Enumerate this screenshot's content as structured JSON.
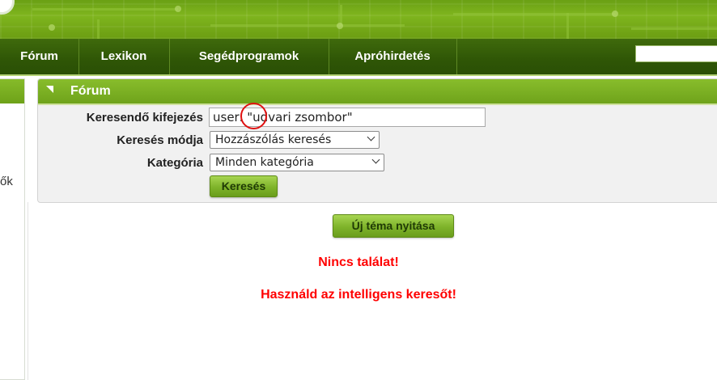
{
  "nav": {
    "items": [
      "Fórum",
      "Lexikon",
      "Segédprogramok",
      "Apróhirdetés"
    ],
    "search_value": ""
  },
  "sidebar": {
    "partial_text": "ők"
  },
  "panel": {
    "title": "Fórum",
    "fields": {
      "query_label": "Keresendő kifejezés",
      "query_value": "user: \"udvari zsombor\"",
      "mode_label": "Keresés módja",
      "mode_value": "Hozzászólás keresés",
      "category_label": "Kategória",
      "category_value": "Minden kategória"
    },
    "search_button": "Keresés"
  },
  "new_topic_button": "Új téma nyitása",
  "messages": {
    "no_result": "Nincs találat!",
    "hint": "Használd az intelligens keresőt!"
  },
  "colors": {
    "accent": "#7fb51e",
    "nav": "#2f5606",
    "error": "#ff0000"
  }
}
